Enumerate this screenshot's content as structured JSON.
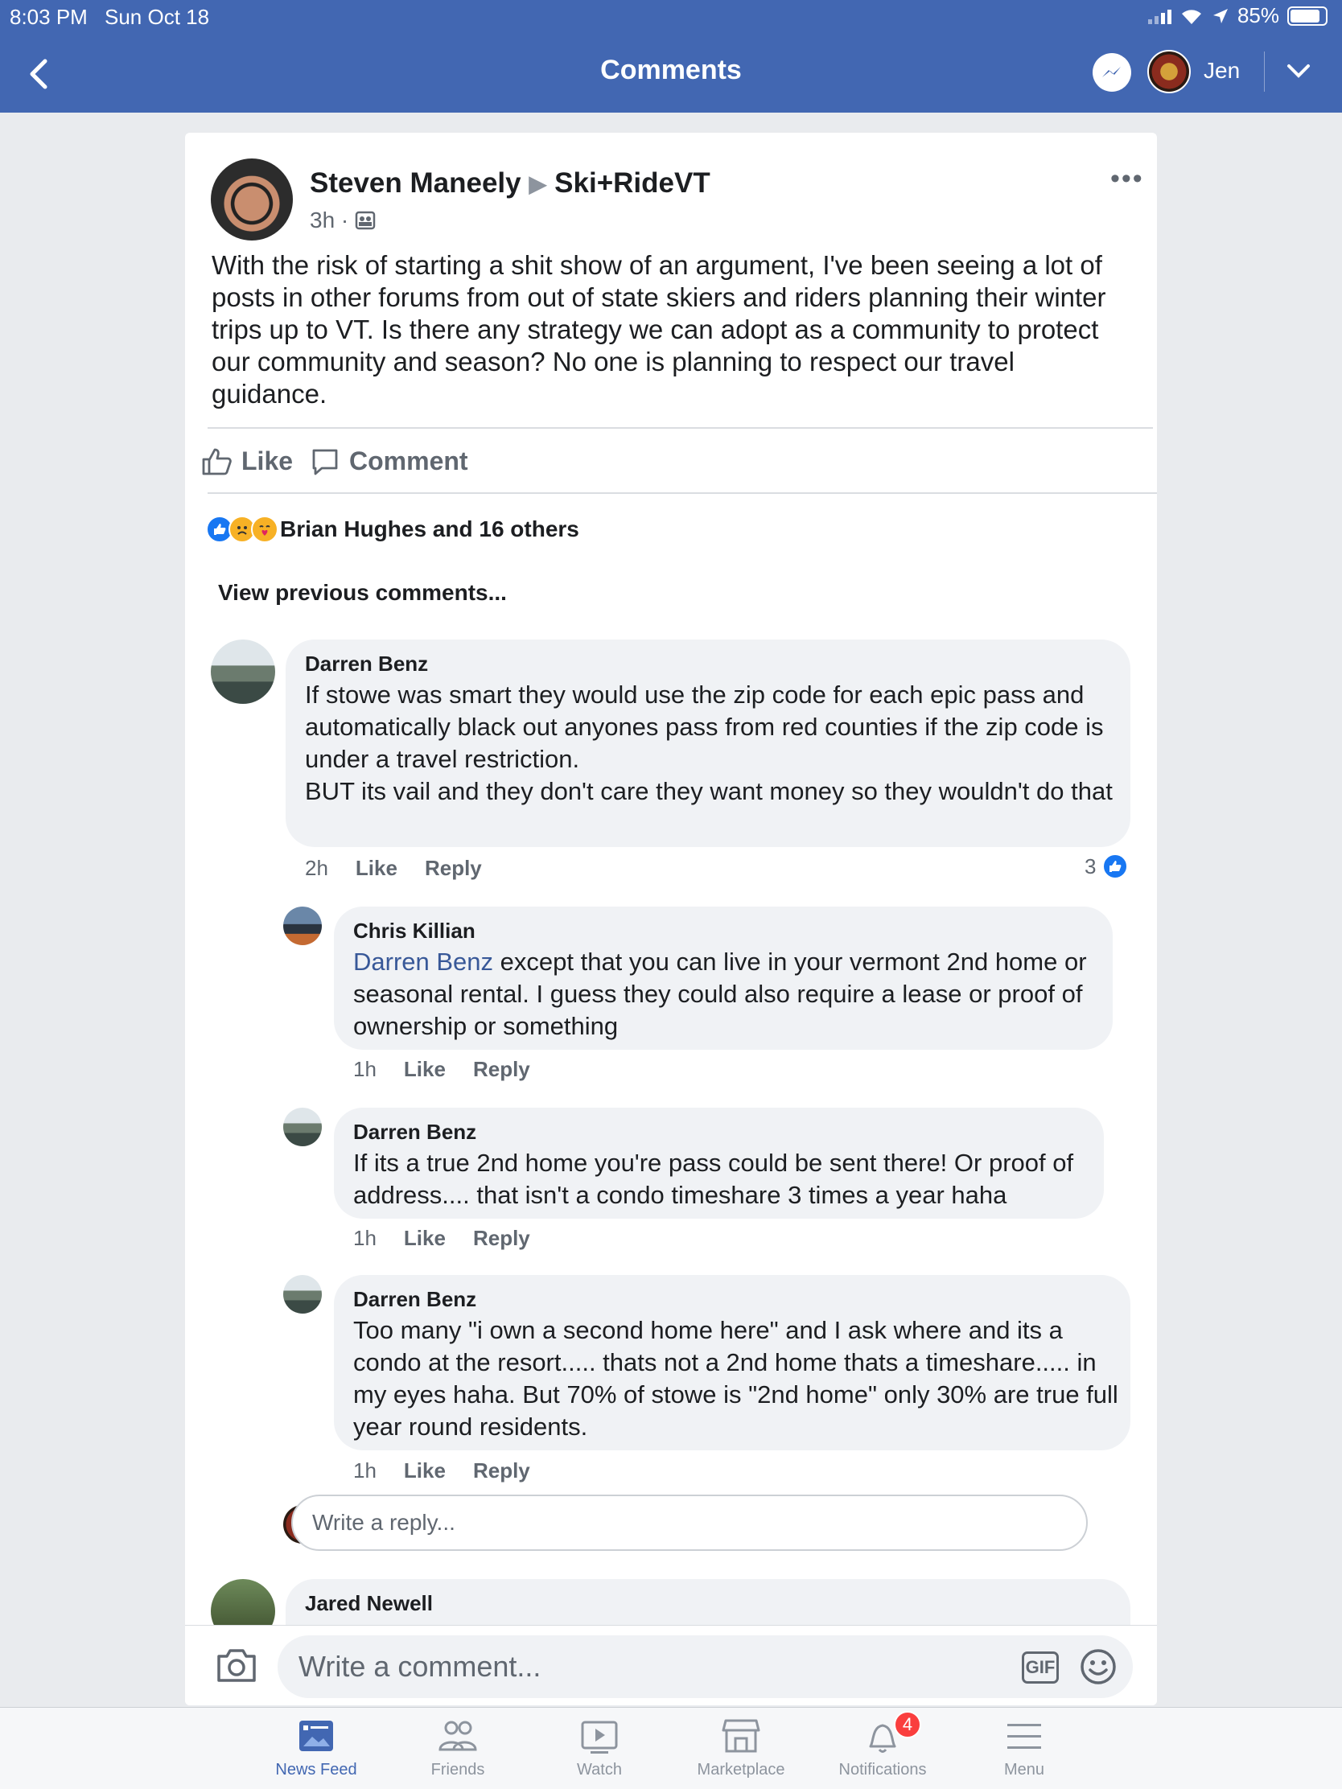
{
  "status_bar": {
    "time": "8:03 PM",
    "date": "Sun Oct 18",
    "battery": "85%"
  },
  "nav": {
    "title": "Comments",
    "user_name": "Jen"
  },
  "post": {
    "author": "Steven Maneely",
    "group": "Ski+RideVT",
    "time": "3h ·",
    "text": "With the risk of starting a shit show of an argument, I've been seeing a lot of posts in other forums from out of state skiers and riders planning their winter trips up to VT.  Is there any strategy we can adopt as a community to protect our community and season? No one is planning to respect our travel guidance.",
    "like_label": "Like",
    "comment_label": "Comment",
    "reactions_text": "Brian Hughes and 16 others",
    "view_previous": "View previous comments..."
  },
  "comments": [
    {
      "name": "Darren Benz",
      "text": "If stowe was smart they would use the zip code for each epic pass and automatically black out anyones pass from red counties if the zip code is under a travel restriction.\nBUT its vail and they don't care they want money so they wouldn't do that",
      "time": "2h",
      "like": "Like",
      "reply": "Reply",
      "like_count": "3"
    },
    {
      "name": "Chris Killian",
      "mention": "Darren Benz",
      "text": " except that you can live in your vermont 2nd home or seasonal rental.  I guess they could also require a lease or proof of ownership or something",
      "time": "1h",
      "like": "Like",
      "reply": "Reply"
    },
    {
      "name": "Darren Benz",
      "text": "If its a true 2nd home you're pass could be sent there! Or proof of address.... that isn't a condo timeshare 3 times a year haha",
      "time": "1h",
      "like": "Like",
      "reply": "Reply"
    },
    {
      "name": "Darren Benz",
      "text": "Too many \"i own a second home here\" and I ask where and its a condo at the resort..... thats not a 2nd home thats a timeshare..... in my eyes haha. But 70% of stowe is \"2nd home\" only 30% are true full year round residents.",
      "time": "1h",
      "like": "Like",
      "reply": "Reply"
    },
    {
      "name": "Jared Newell"
    }
  ],
  "reply_placeholder": "Write a reply...",
  "comment_placeholder": "Write a comment...",
  "gif_label": "GIF",
  "tabs": [
    {
      "label": "News Feed",
      "icon": "news-feed-icon",
      "active": true
    },
    {
      "label": "Friends",
      "icon": "friends-icon"
    },
    {
      "label": "Watch",
      "icon": "watch-icon"
    },
    {
      "label": "Marketplace",
      "icon": "marketplace-icon"
    },
    {
      "label": "Notifications",
      "icon": "bell-icon",
      "badge": "4"
    },
    {
      "label": "Menu",
      "icon": "menu-icon"
    }
  ],
  "colors": {
    "brand": "#4267b2",
    "link": "#385898",
    "bubble": "#f0f2f5",
    "badge": "#fa3e3e"
  }
}
